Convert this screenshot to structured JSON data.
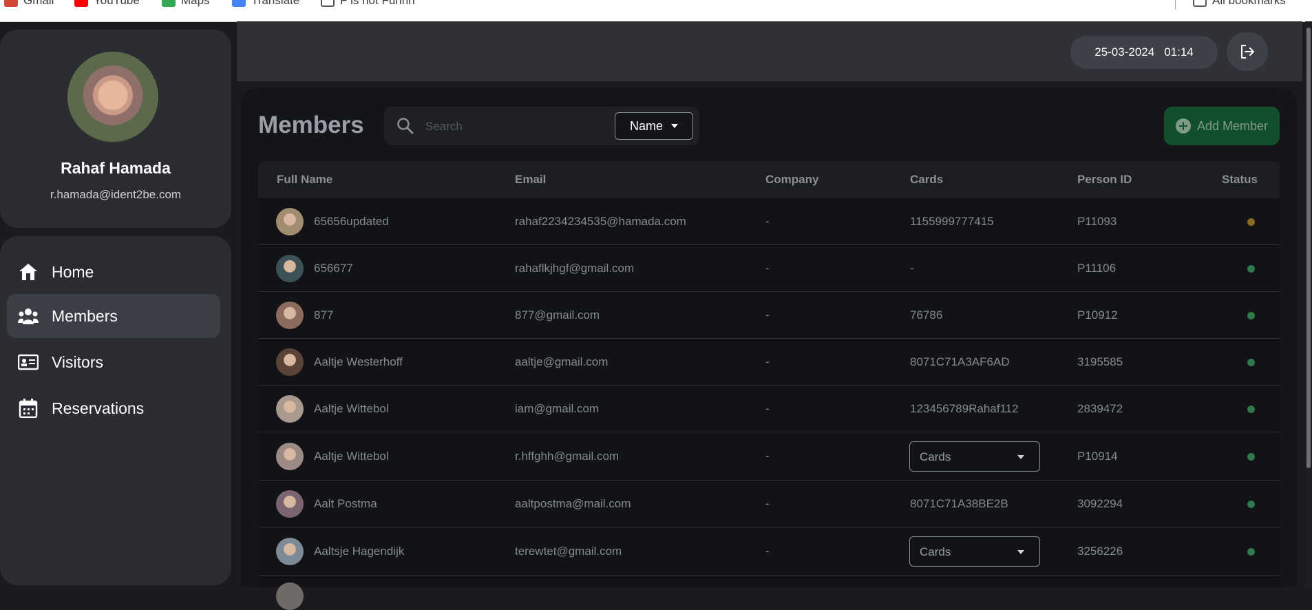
{
  "browser": {
    "bookmarks": [
      {
        "label": "Gmail",
        "icon": "gmail-icon"
      },
      {
        "label": "YouTube",
        "icon": "youtube-icon"
      },
      {
        "label": "Maps",
        "icon": "maps-icon"
      },
      {
        "label": "Translate",
        "icon": "translate-icon"
      },
      {
        "label": "F is not Funnn",
        "icon": "folder-icon"
      }
    ],
    "all_bookmarks": "All bookmarks"
  },
  "profile": {
    "name": "Rahaf Hamada",
    "email": "r.hamada@ident2be.com"
  },
  "nav": {
    "items": [
      {
        "label": "Home",
        "icon": "home-icon"
      },
      {
        "label": "Members",
        "icon": "members-icon",
        "active": true
      },
      {
        "label": "Visitors",
        "icon": "id-card-icon"
      },
      {
        "label": "Reservations",
        "icon": "calendar-icon"
      }
    ]
  },
  "header": {
    "date": "25-03-2024",
    "time": "01:14",
    "logout_icon": "logout-icon"
  },
  "main": {
    "title": "Members",
    "search_placeholder": "Search",
    "filter_value": "Name",
    "add_label": "Add Member"
  },
  "table": {
    "columns": [
      "Full Name",
      "Email",
      "Company",
      "Cards",
      "Person ID",
      "Status"
    ],
    "rows": [
      {
        "name": "65656updated",
        "email": "rahaf2234234535@hamada.com",
        "company": "-",
        "cards": "1155999777415",
        "person_id": "P11093",
        "status_color": "#8a6a1c",
        "avatar": "#a08c6e"
      },
      {
        "name": "656677",
        "email": "rahaflkjhgf@gmail.com",
        "company": "-",
        "cards": "-",
        "person_id": "P11106",
        "status_color": "#2e7a4a",
        "avatar": "#3d5257"
      },
      {
        "name": "877",
        "email": "877@gmail.com",
        "company": "-",
        "cards": "76786",
        "person_id": "P10912",
        "status_color": "#2e7a4a",
        "avatar": "#8c6a5e"
      },
      {
        "name": "Aaltje Westerhoff",
        "email": "aaltje@gmail.com",
        "company": "-",
        "cards": "8071C71A3AF6AD",
        "person_id": "3195585",
        "status_color": "#2e7a4a",
        "avatar": "#5a4438"
      },
      {
        "name": "Aaltje Wittebol",
        "email": "iam@gmail.com",
        "company": "-",
        "cards": "123456789Rahaf112",
        "person_id": "2839472",
        "status_color": "#2e7a4a",
        "avatar": "#a89a8e"
      },
      {
        "name": "Aaltje Wittebol",
        "email": "r.hffghh@gmail.com",
        "company": "-",
        "cards_select": "Cards",
        "person_id": "P10914",
        "status_color": "#2e7a4a",
        "avatar": "#9c8a84"
      },
      {
        "name": "Aalt Postma",
        "email": "aaltpostma@mail.com",
        "company": "-",
        "cards": "8071C71A38BE2B",
        "person_id": "3092294",
        "status_color": "#2e7a4a",
        "avatar": "#7a6470"
      },
      {
        "name": "Aaltsje Hagendijk",
        "email": "terewtet@gmail.com",
        "company": "-",
        "cards_select": "Cards",
        "person_id": "3256226",
        "status_color": "#2e7a4a",
        "avatar": "#7c8a96"
      }
    ]
  }
}
